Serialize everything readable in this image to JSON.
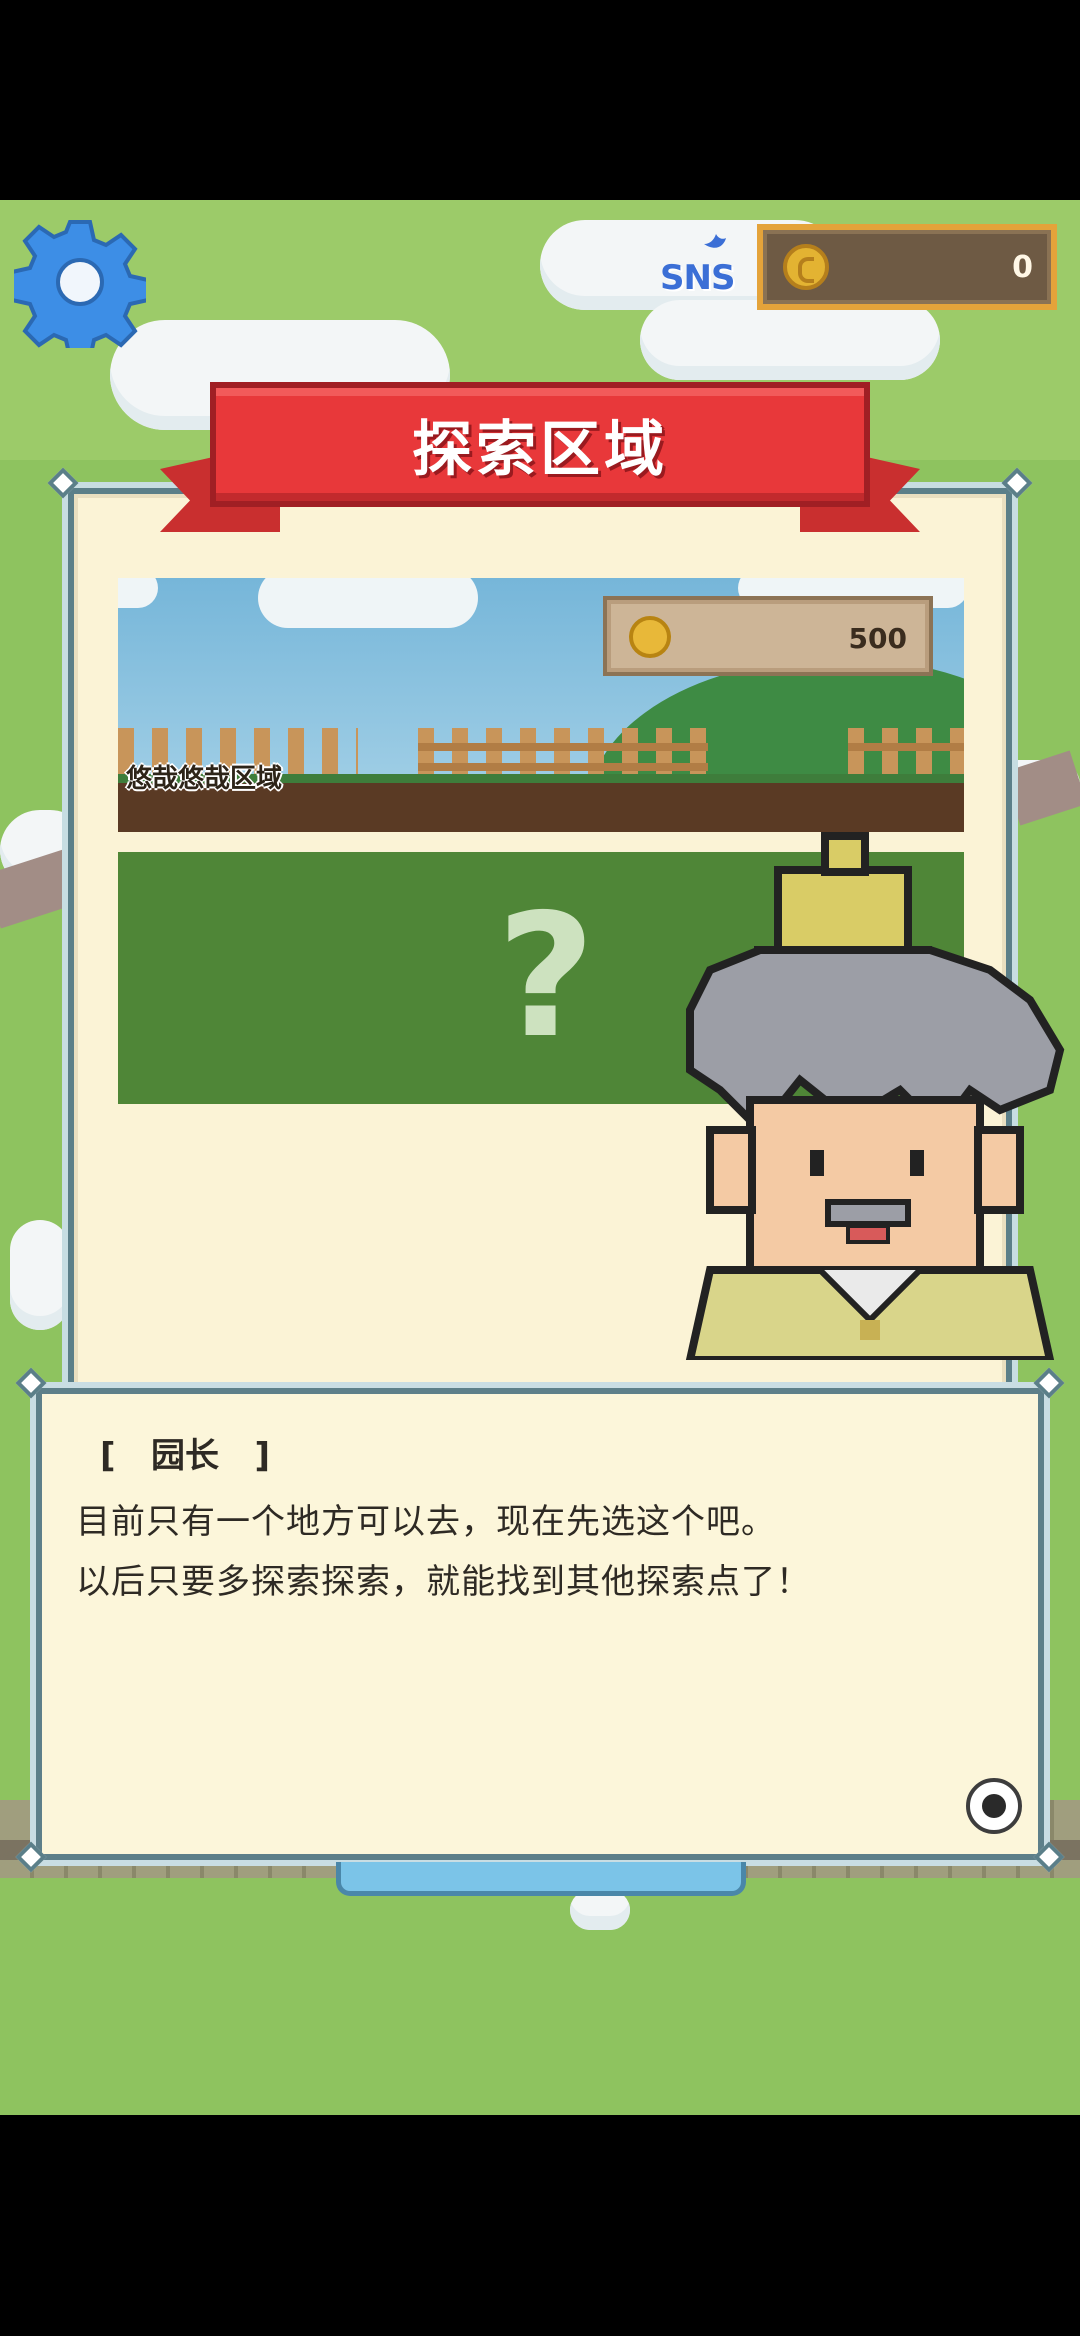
{
  "hud": {
    "settings_icon": "gear-icon",
    "sns_label": "SNS",
    "coin_icon": "coin-icon",
    "coins": "0"
  },
  "panel": {
    "title": "探索区域"
  },
  "areas": [
    {
      "name": "悠哉悠哉区域",
      "price": "500",
      "price_icon": "coin-icon",
      "locked": false
    },
    {
      "name": "",
      "locked": true,
      "lock_symbol": "?"
    }
  ],
  "dialog": {
    "speaker": "[   园长   ]",
    "lines": [
      "目前只有一个地方可以去，现在先选这个吧。",
      "以后只要多探索探索，就能找到其他探索点了！"
    ],
    "next_icon": "next-indicator-icon"
  },
  "colors": {
    "ribbon": "#e8383a",
    "panel_bg": "#fbf3d6",
    "grass": "#8ec35f",
    "locked_card": "#4f8637"
  }
}
